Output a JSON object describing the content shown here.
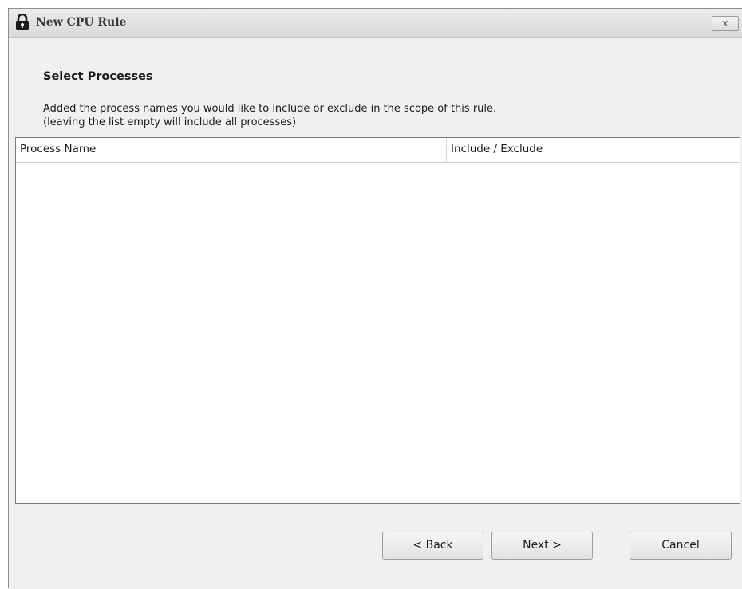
{
  "window": {
    "title": "New CPU Rule",
    "close_label": "x"
  },
  "header": {
    "section_title": "Select Processes",
    "description_line1": "Added the process names you would like to include or exclude in the scope of this rule.",
    "description_line2": "(leaving the list empty will include all processes)"
  },
  "process_list": {
    "columns": [
      "Process Name",
      "Include / Exclude"
    ],
    "rows": []
  },
  "buttons": {
    "back_label": "< Back",
    "next_label": "Next >",
    "cancel_label": "Cancel"
  },
  "icons": {
    "title_icon": "lock-icon",
    "close_icon": "close-icon"
  }
}
